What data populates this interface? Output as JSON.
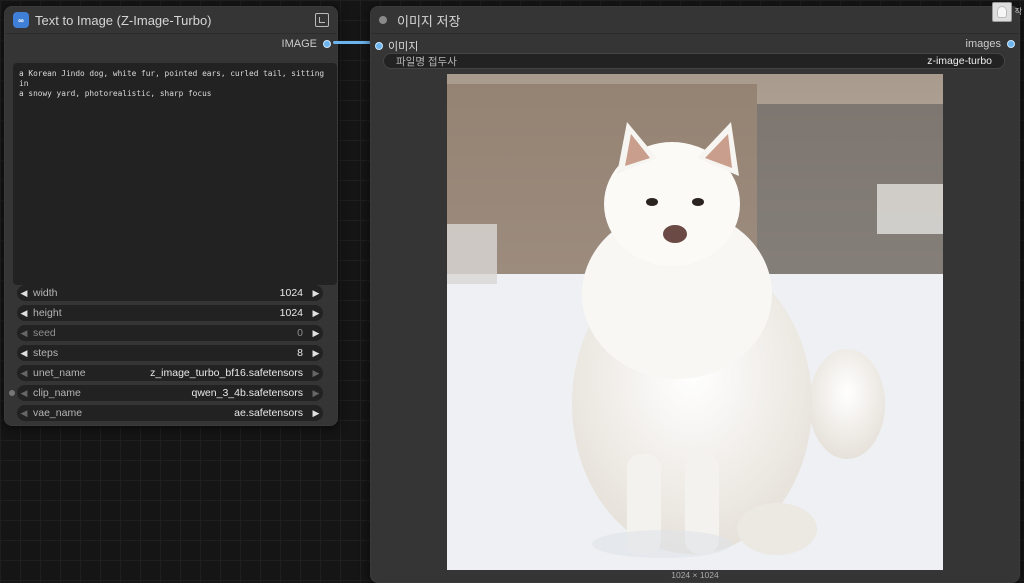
{
  "text_to_image_node": {
    "title": "Text to Image (Z-Image-Turbo)",
    "app_icon": "workflow-app-icon",
    "output_label": "IMAGE",
    "prompt": "a Korean Jindo dog, white fur, pointed ears, curled tail, sitting in\na snowy yard, photorealistic, sharp focus",
    "widgets": [
      {
        "label": "width",
        "value": "1024"
      },
      {
        "label": "height",
        "value": "1024"
      },
      {
        "label": "seed",
        "value": "0"
      },
      {
        "label": "steps",
        "value": "8"
      },
      {
        "label": "unet_name",
        "value": "z_image_turbo_bf16.safetensors"
      },
      {
        "label": "clip_name",
        "value": "qwen_3_4b.safetensors"
      },
      {
        "label": "vae_name",
        "value": "ae.safetensors"
      }
    ]
  },
  "save_image_node": {
    "title": "이미지 저장",
    "input_label": "이미지",
    "output_label": "images",
    "prefix_label": "파일명 접두사",
    "prefix_value": "z-image-turbo",
    "image_size": "1024 × 1024",
    "image_subject": "white-jindo-dog-in-snow"
  },
  "corner": {
    "label": "작"
  },
  "colors": {
    "accent": "#6cb4ee",
    "node_bg": "#353535",
    "canvas_bg": "#151515"
  }
}
